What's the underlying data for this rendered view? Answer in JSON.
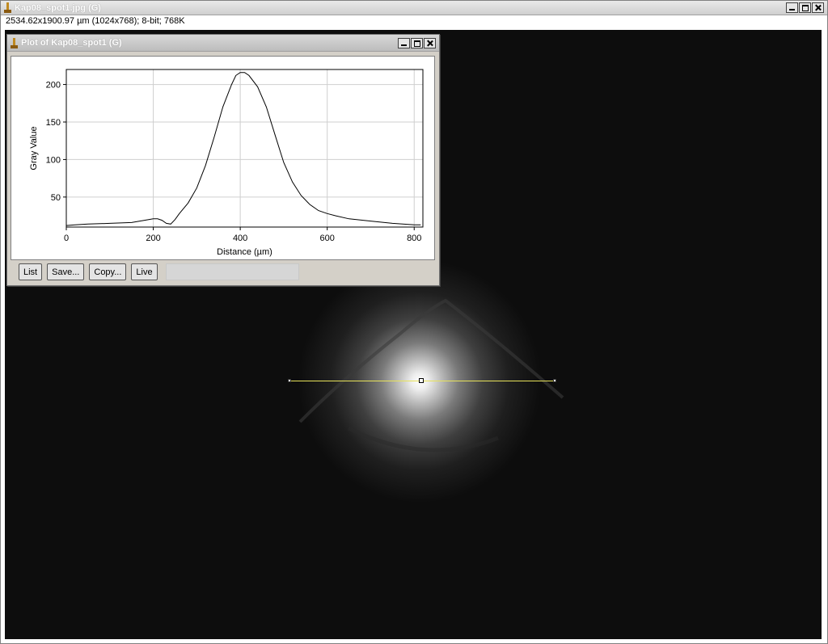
{
  "main_window": {
    "title": "Kap08_spot1.jpg (G)",
    "info": "2534.62x1900.97 µm (1024x768); 8-bit; 768K"
  },
  "plot_window": {
    "title": "Plot of Kap08_spot1 (G)",
    "buttons": {
      "list": "List",
      "save": "Save...",
      "copy": "Copy...",
      "live": "Live"
    }
  },
  "chart_data": {
    "type": "line",
    "xlabel": "Distance (µm)",
    "ylabel": "Gray Value",
    "xlim": [
      0,
      820
    ],
    "ylim": [
      10,
      220
    ],
    "x_ticks": [
      0,
      200,
      400,
      600,
      800
    ],
    "y_ticks": [
      50,
      100,
      150,
      200
    ],
    "grid": true,
    "series": [
      {
        "color": "#000000",
        "x": [
          0,
          20,
          50,
          100,
          150,
          180,
          200,
          210,
          220,
          230,
          240,
          250,
          260,
          280,
          300,
          320,
          340,
          360,
          380,
          390,
          400,
          410,
          420,
          440,
          460,
          480,
          500,
          520,
          540,
          560,
          580,
          600,
          620,
          650,
          700,
          750,
          800,
          815
        ],
        "y": [
          12,
          13,
          14,
          15,
          16,
          19,
          21,
          21,
          19,
          15,
          14,
          20,
          28,
          42,
          62,
          92,
          130,
          170,
          200,
          212,
          216,
          216,
          212,
          197,
          170,
          133,
          96,
          70,
          52,
          40,
          32,
          28,
          25,
          21,
          18,
          15,
          13,
          13
        ]
      }
    ]
  }
}
